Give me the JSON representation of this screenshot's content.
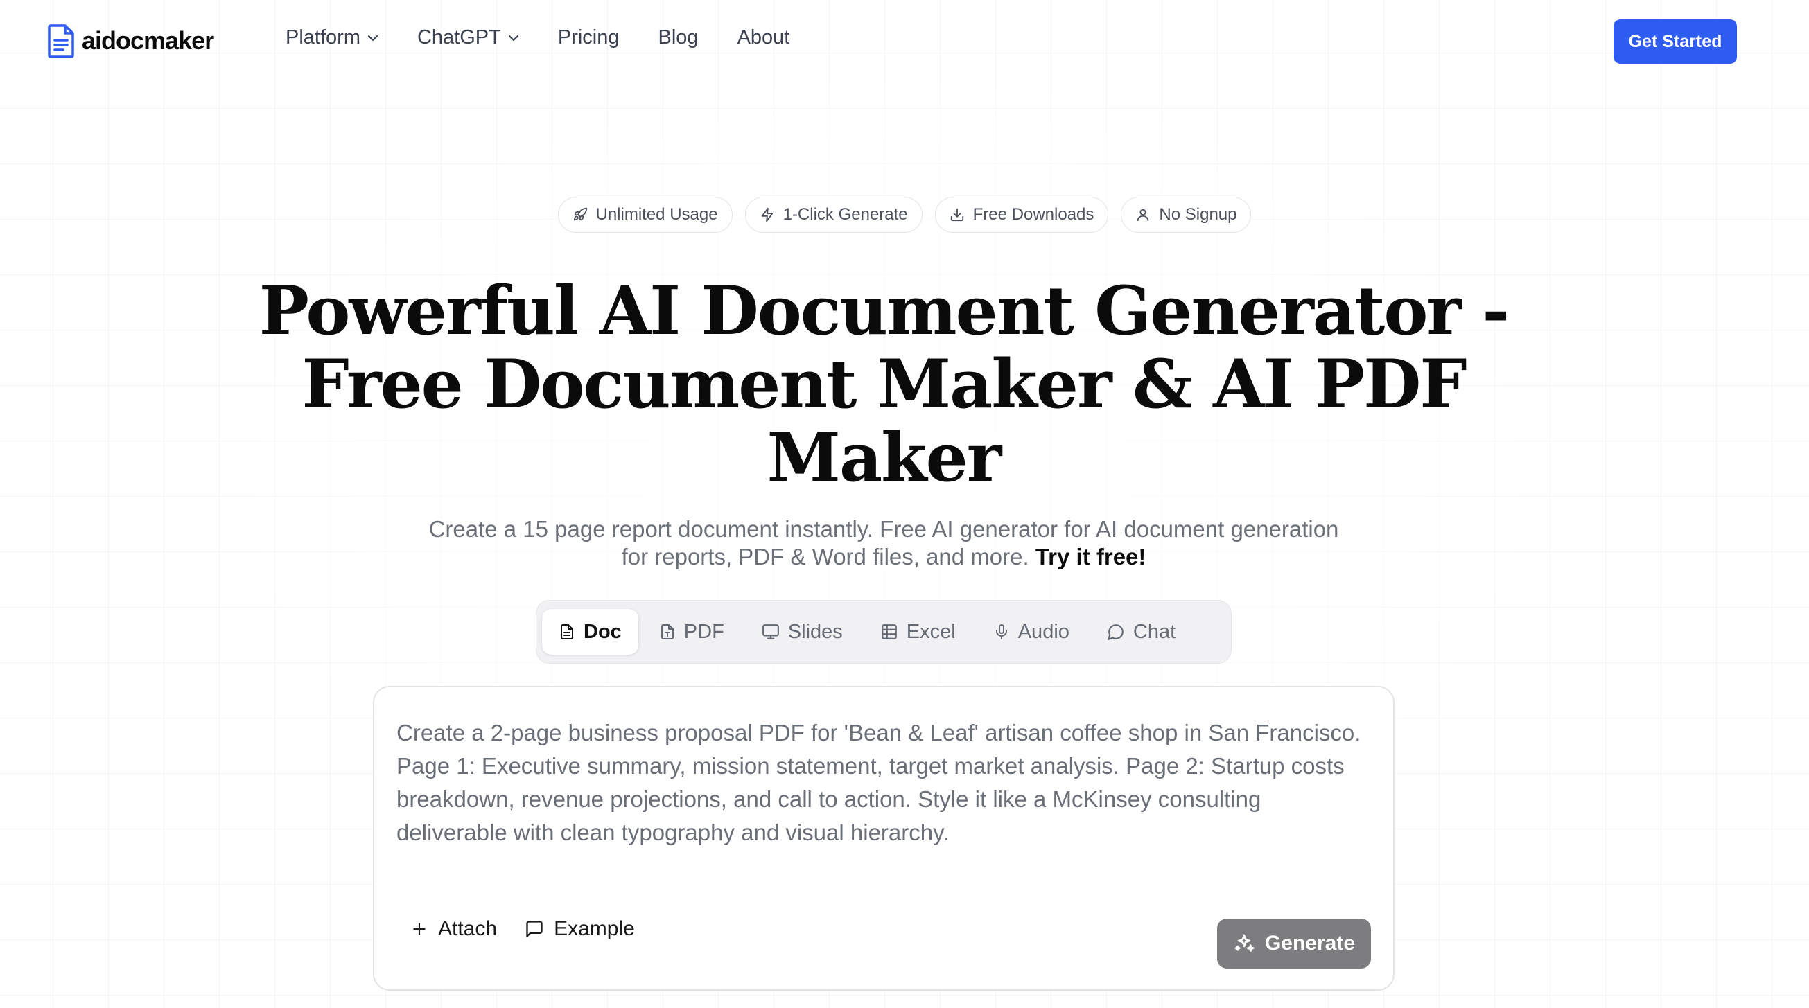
{
  "brand": {
    "name": "aidocmaker",
    "accent": "#2f5cf0"
  },
  "nav": {
    "links": [
      {
        "label": "Platform",
        "dropdown": true
      },
      {
        "label": "ChatGPT",
        "dropdown": true
      },
      {
        "label": "Pricing",
        "dropdown": false
      },
      {
        "label": "Blog",
        "dropdown": false
      },
      {
        "label": "About",
        "dropdown": false
      }
    ],
    "cta": "Get Started"
  },
  "badges": [
    {
      "label": "Unlimited Usage",
      "icon": "rocket-icon"
    },
    {
      "label": "1-Click Generate",
      "icon": "lightning-icon"
    },
    {
      "label": "Free Downloads",
      "icon": "download-icon"
    },
    {
      "label": "No Signup",
      "icon": "user-icon"
    }
  ],
  "hero": {
    "title": "Powerful AI Document Generator - Free Document Maker & AI PDF Maker",
    "subtitle": "Create a 15 page report document instantly. Free AI generator for AI document generation for reports, PDF & Word files, and more.",
    "subtitle_cta": "Try it free!"
  },
  "tabs": [
    {
      "label": "Doc",
      "icon": "document-icon",
      "active": true
    },
    {
      "label": "PDF",
      "icon": "pdf-file-icon",
      "active": false
    },
    {
      "label": "Slides",
      "icon": "presentation-icon",
      "active": false
    },
    {
      "label": "Excel",
      "icon": "table-icon",
      "active": false
    },
    {
      "label": "Audio",
      "icon": "microphone-icon",
      "active": false
    },
    {
      "label": "Chat",
      "icon": "chat-bubble-icon",
      "active": false
    }
  ],
  "prompt": {
    "value": "Create a 2-page business proposal PDF for 'Bean & Leaf' artisan coffee shop in San Francisco. Page 1: Executive summary, mission statement, target market analysis. Page 2: Startup costs breakdown, revenue projections, and call to action. Style it like a McKinsey consulting deliverable with clean typography and visual hierarchy.",
    "attach_label": "Attach",
    "example_label": "Example",
    "generate_label": "Generate"
  }
}
